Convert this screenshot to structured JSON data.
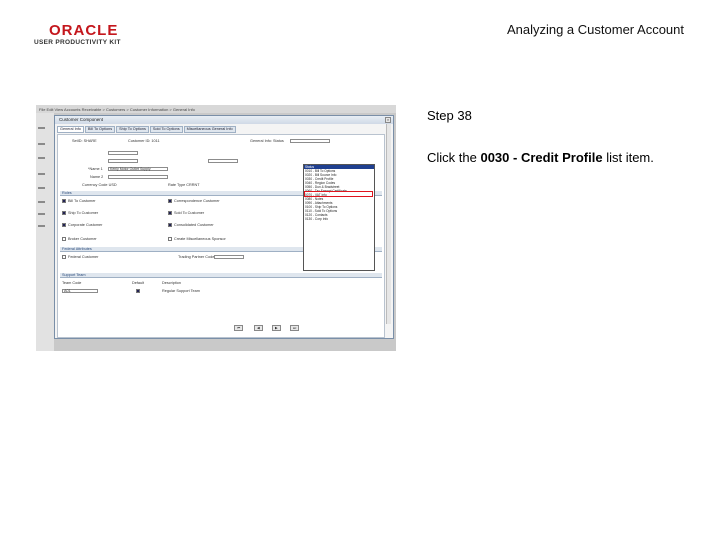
{
  "logo": {
    "brand": "ORACLE",
    "product": "USER PRODUCTIVITY KIT"
  },
  "header": {
    "title": "Analyzing a Customer Account"
  },
  "step": {
    "label": "Step 38"
  },
  "instruction": {
    "prefix": "Click the ",
    "target": "0030 - Credit Profile",
    "suffix": " list item."
  },
  "screenshot": {
    "window_title": "Customer Component",
    "tabs": [
      "General Info",
      "Bill To Options",
      "Ship To Options",
      "Sold To Options",
      "Miscellaneous General Info"
    ],
    "fields": {
      "setid": "SetID: SHARE",
      "customer_id": "Customer ID: 1011",
      "general_info_label": "General Info: Status",
      "name1_label": "*Name 1",
      "name1_value": "Kenly Motor Outlet Supply",
      "name2_label": "Name 2",
      "currency_label": "Currency Code USD",
      "rate_type_label": "Rate Type CRRNT"
    },
    "dropdown": {
      "items": [
        "Status",
        "0010 - Bill To Options",
        "0020 - Bill Source Info",
        "0030 - Credit Profile",
        "0040 - Region Codes",
        "0050 - Dun & Bradstreet",
        "0060 - Tax Exempt Certificate",
        "0070 - VAT Info",
        "0080 - Notes",
        "0090 - Attachments",
        "0100 - Ship To Options",
        "0110 - Sold To Options",
        "0120 - Contacts",
        "0130 - Corp Info"
      ],
      "highlighted_index": 0
    },
    "roles_header": "Roles",
    "roles": [
      {
        "label": "Bill To Customer",
        "checked": true
      },
      {
        "label": "Correspondence Customer",
        "checked": true
      },
      {
        "label": "Ship To Customer",
        "checked": true
      },
      {
        "label": "Sold To Customer",
        "checked": true
      },
      {
        "label": "Corporate Customer",
        "checked": true
      },
      {
        "label": "Consolidated Customer",
        "checked": true
      },
      {
        "label": "Broker Customer",
        "checked": false
      },
      {
        "label": "Create Miscellaneous Sponsor",
        "checked": false
      }
    ],
    "federal_header": "Federal Attributes",
    "federal_customer_label": "Federal Customer",
    "federal_partner_label": "Trading Partner Code",
    "support_header": "Support Team",
    "support_columns": [
      "Team Code",
      "Default",
      "Description"
    ],
    "support_row": {
      "team": "A01",
      "description": "Regular Support Team"
    },
    "top_menu": "File   Edit   View   Accounts Receivable  >  Customers  >  Customer Information  >  General Info"
  },
  "colors": {
    "highlight": "#e0141e",
    "brand": "#c4161c"
  }
}
